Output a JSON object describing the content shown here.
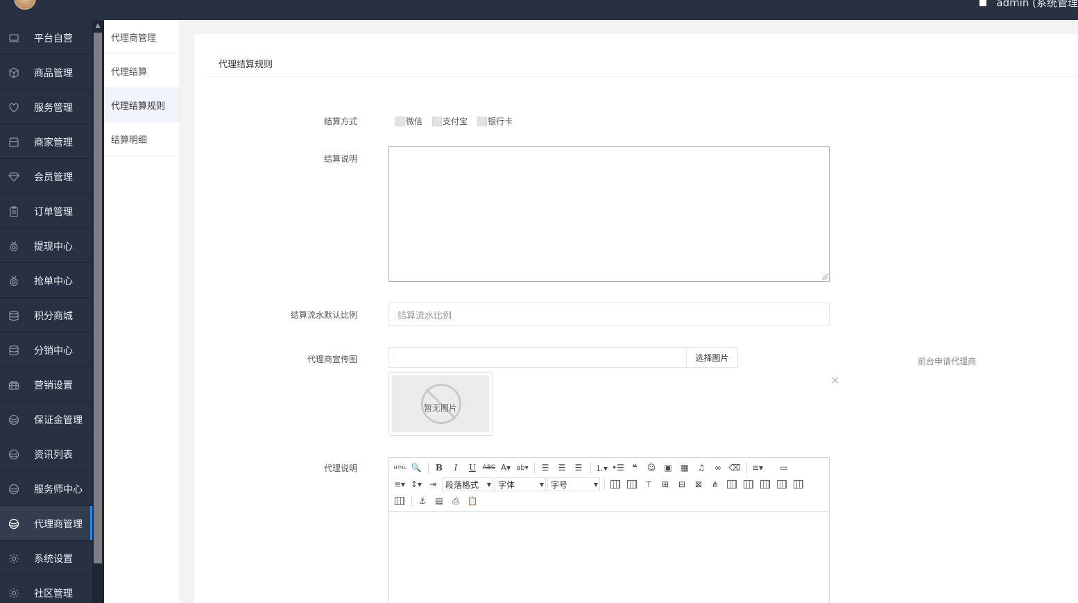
{
  "topbar": {
    "user_label": "admin (系统管理"
  },
  "sidebar": {
    "items": [
      {
        "label": "平台自营",
        "icon": "laptop-icon"
      },
      {
        "label": "商品管理",
        "icon": "cube-icon"
      },
      {
        "label": "服务管理",
        "icon": "heart-icon"
      },
      {
        "label": "商家管理",
        "icon": "store-icon"
      },
      {
        "label": "会员管理",
        "icon": "diamond-icon"
      },
      {
        "label": "订单管理",
        "icon": "clipboard-icon"
      },
      {
        "label": "提现中心",
        "icon": "medal-icon"
      },
      {
        "label": "抢单中心",
        "icon": "medal-icon"
      },
      {
        "label": "积分商城",
        "icon": "database-icon"
      },
      {
        "label": "分销中心",
        "icon": "database-icon"
      },
      {
        "label": "营销设置",
        "icon": "gift-icon"
      },
      {
        "label": "保证金管理",
        "icon": "shield-icon"
      },
      {
        "label": "资讯列表",
        "icon": "shield-icon"
      },
      {
        "label": "服务师中心",
        "icon": "shield-icon"
      },
      {
        "label": "代理商管理",
        "icon": "shield-icon",
        "active": true
      },
      {
        "label": "系统设置",
        "icon": "gear-icon"
      },
      {
        "label": "社区管理",
        "icon": "gear-icon"
      }
    ]
  },
  "submenu": {
    "items": [
      {
        "label": "代理商管理"
      },
      {
        "label": "代理结算"
      },
      {
        "label": "代理结算规则",
        "active": true
      },
      {
        "label": "结算明细"
      }
    ]
  },
  "panel": {
    "title": "代理结算规则"
  },
  "form": {
    "method_label": "结算方式",
    "methods": [
      "微信",
      "支付宝",
      "银行卡"
    ],
    "desc_label": "结算说明",
    "ratio_label": "结算流水默认比例",
    "ratio_placeholder": "结算流水比例",
    "image_label": "代理商宣传图",
    "image_button": "选择图片",
    "image_hint": "前台申请代理商",
    "no_image": "暂无图片",
    "close_symbol": "×",
    "agent_desc_label": "代理说明"
  },
  "editor": {
    "html_label": "HTML",
    "paragraph_format": "段落格式",
    "font_family": "字体",
    "font_size": "字号"
  },
  "colors": {
    "sidebar_bg": "#283142",
    "active_accent": "#1a8cf0"
  }
}
